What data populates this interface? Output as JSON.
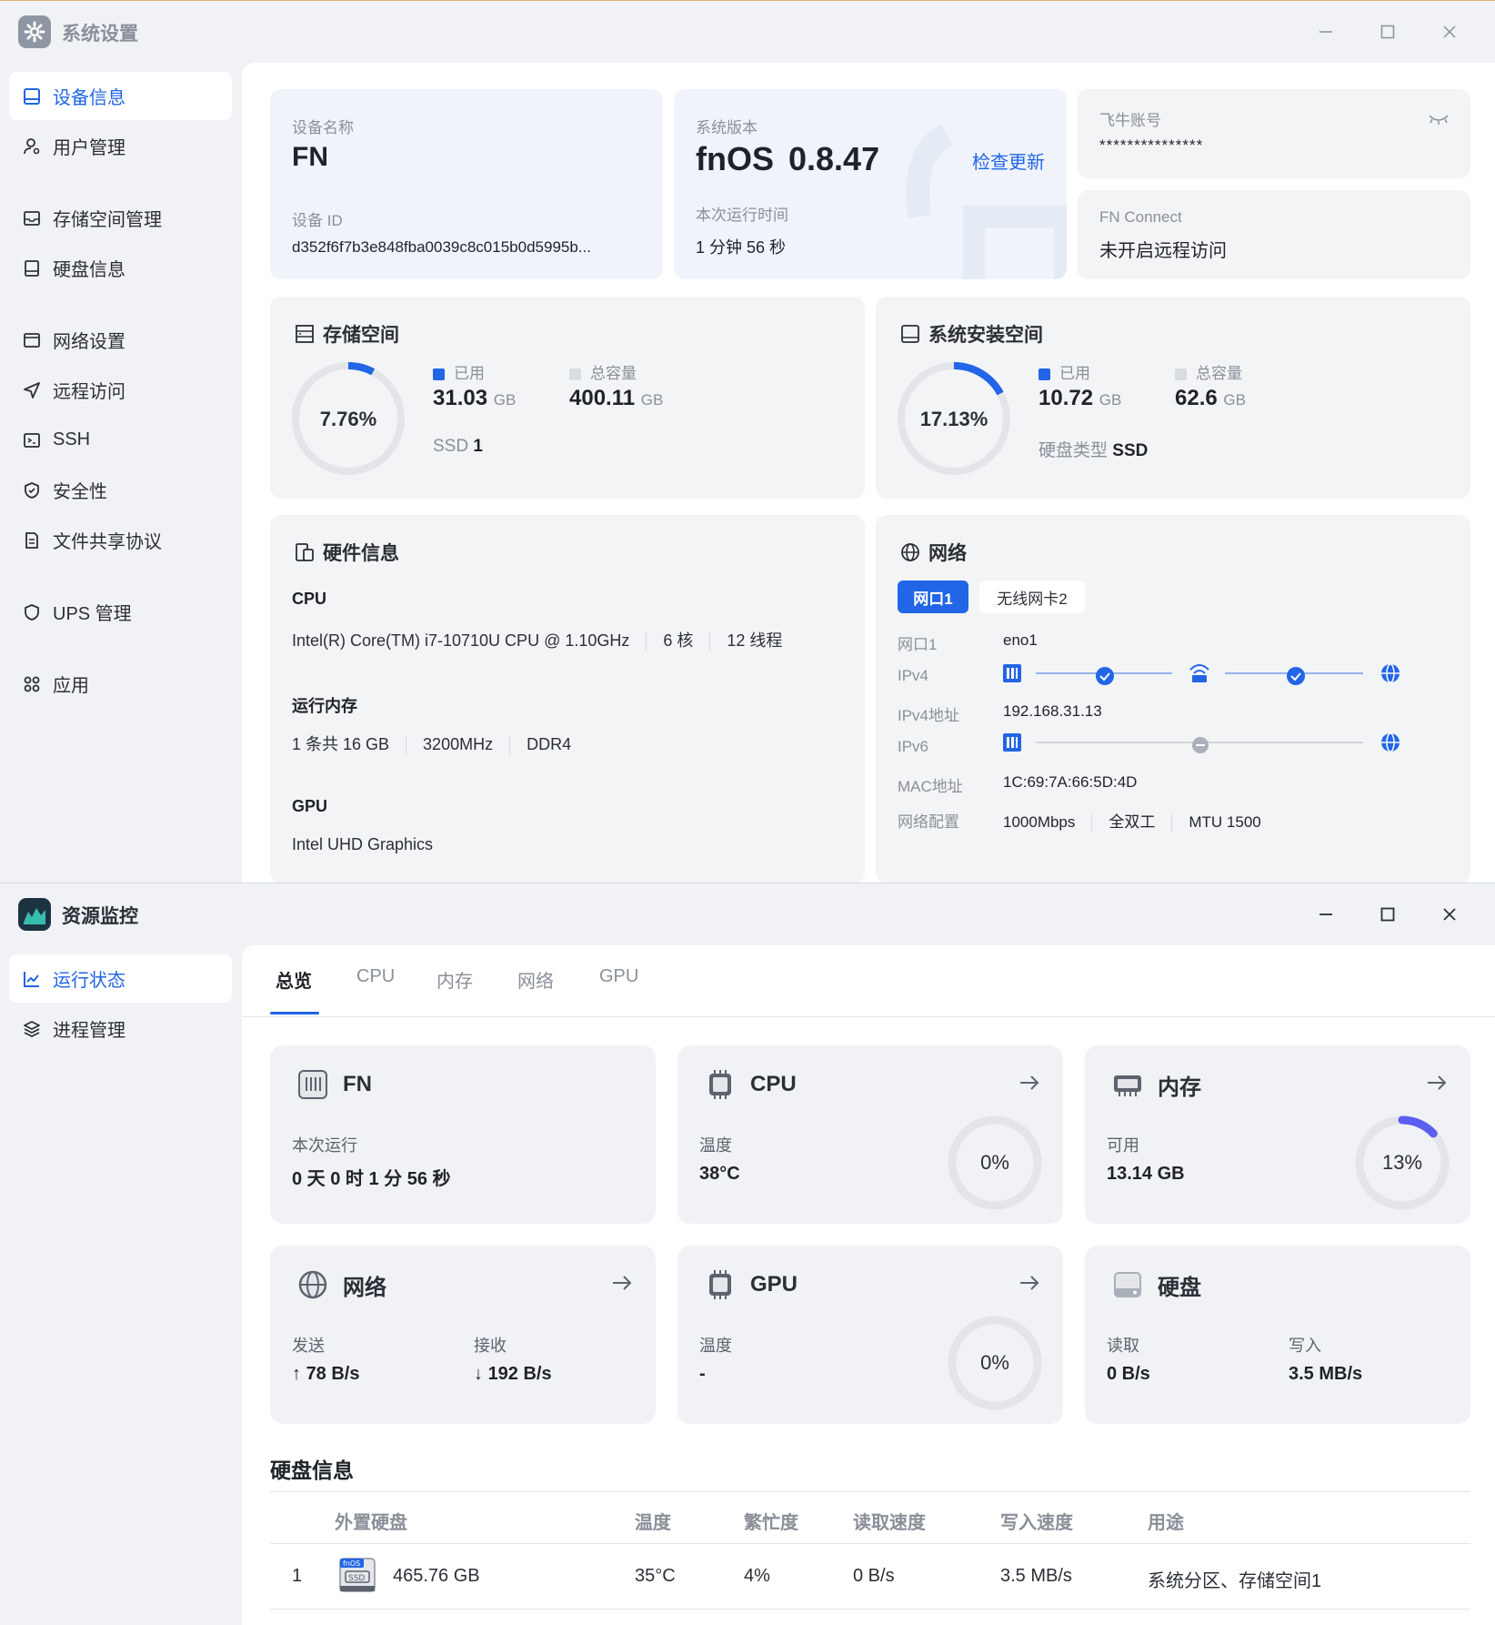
{
  "settings_window": {
    "title": "系统设置",
    "sidebar": [
      {
        "label": "设备信息"
      },
      {
        "label": "用户管理"
      },
      {
        "label": "存储空间管理"
      },
      {
        "label": "硬盘信息"
      },
      {
        "label": "网络设置"
      },
      {
        "label": "远程访问"
      },
      {
        "label": "SSH"
      },
      {
        "label": "安全性"
      },
      {
        "label": "文件共享协议"
      },
      {
        "label": "UPS 管理"
      },
      {
        "label": "应用"
      }
    ],
    "device": {
      "name_label": "设备名称",
      "name": "FN",
      "id_label": "设备 ID",
      "id": "d352f6f7b3e848fba0039c8c015b0d5995b..."
    },
    "version": {
      "label": "系统版本",
      "os": "fnOS",
      "number": "0.8.47",
      "check_update": "检查更新",
      "uptime_label": "本次运行时间",
      "uptime": "1 分钟 56 秒"
    },
    "account": {
      "label": "飞牛账号",
      "value": "***************"
    },
    "connect": {
      "label": "FN Connect",
      "value": "未开启远程访问"
    },
    "storage": {
      "title": "存储空间",
      "percent": "7.76%",
      "fraction": 0.0776,
      "used_label": "已用",
      "used": "31.03",
      "used_unit": "GB",
      "total_label": "总容量",
      "total": "400.11",
      "total_unit": "GB",
      "ssd_label": "SSD",
      "ssd_count": "1"
    },
    "system_space": {
      "title": "系统安装空间",
      "percent": "17.13%",
      "fraction": 0.1713,
      "used_label": "已用",
      "used": "10.72",
      "used_unit": "GB",
      "total_label": "总容量",
      "total": "62.6",
      "total_unit": "GB",
      "disk_type_label": "硬盘类型",
      "disk_type": "SSD"
    },
    "hardware": {
      "title": "硬件信息",
      "cpu_label": "CPU",
      "cpu_model": "Intel(R) Core(TM) i7-10710U CPU @ 1.10GHz",
      "cpu_cores": "6 核",
      "cpu_threads": "12 线程",
      "mem_label": "运行内存",
      "mem_size": "1 条共 16 GB",
      "mem_speed": "3200MHz",
      "mem_type": "DDR4",
      "gpu_label": "GPU",
      "gpu_model": "Intel UHD Graphics"
    },
    "network": {
      "title": "网络",
      "tabs": [
        "网口1",
        "无线网卡2"
      ],
      "rows": [
        {
          "label": "网口1",
          "value": "eno1"
        },
        {
          "label": "IPv4",
          "value": ""
        },
        {
          "label": "IPv4地址",
          "value": "192.168.31.13"
        },
        {
          "label": "IPv6",
          "value": ""
        },
        {
          "label": "MAC地址",
          "value": "1C:69:7A:66:5D:4D"
        },
        {
          "label": "网络配置",
          "value": ""
        }
      ],
      "config": [
        "1000Mbps",
        "全双工",
        "MTU 1500"
      ]
    },
    "colors": {
      "accent": "#2265e6",
      "ring_track": "#e3e5e9"
    }
  },
  "monitor_window": {
    "title": "资源监控",
    "sidebar": [
      {
        "label": "运行状态"
      },
      {
        "label": "进程管理"
      }
    ],
    "tabs": [
      "总览",
      "CPU",
      "内存",
      "网络",
      "GPU"
    ],
    "cards": {
      "fn": {
        "title": "FN",
        "label": "本次运行",
        "value": "0 天 0 时 1 分 56 秒"
      },
      "cpu": {
        "title": "CPU",
        "label": "温度",
        "value": "38°C",
        "percent": "0%",
        "fraction": 0
      },
      "mem": {
        "title": "内存",
        "label": "可用",
        "value": "13.14 GB",
        "percent": "13%",
        "fraction": 0.13
      },
      "net": {
        "title": "网络",
        "send_label": "发送",
        "send": "78 B/s",
        "recv_label": "接收",
        "recv": "192 B/s"
      },
      "gpu": {
        "title": "GPU",
        "label": "温度",
        "value": "-",
        "percent": "0%",
        "fraction": 0
      },
      "disk": {
        "title": "硬盘",
        "read_label": "读取",
        "read": "0 B/s",
        "write_label": "写入",
        "write": "3.5 MB/s"
      }
    },
    "disk_table": {
      "title": "硬盘信息",
      "headers": [
        "外置硬盘",
        "温度",
        "繁忙度",
        "读取速度",
        "写入速度",
        "用途"
      ],
      "rows": [
        {
          "index": "1",
          "size": "465.76 GB",
          "temp": "35°C",
          "busy": "4%",
          "read": "0 B/s",
          "write": "3.5 MB/s",
          "usage": "系统分区、存储空间1"
        }
      ]
    },
    "colors": {
      "mem_ring": "#5b5ef0"
    }
  }
}
